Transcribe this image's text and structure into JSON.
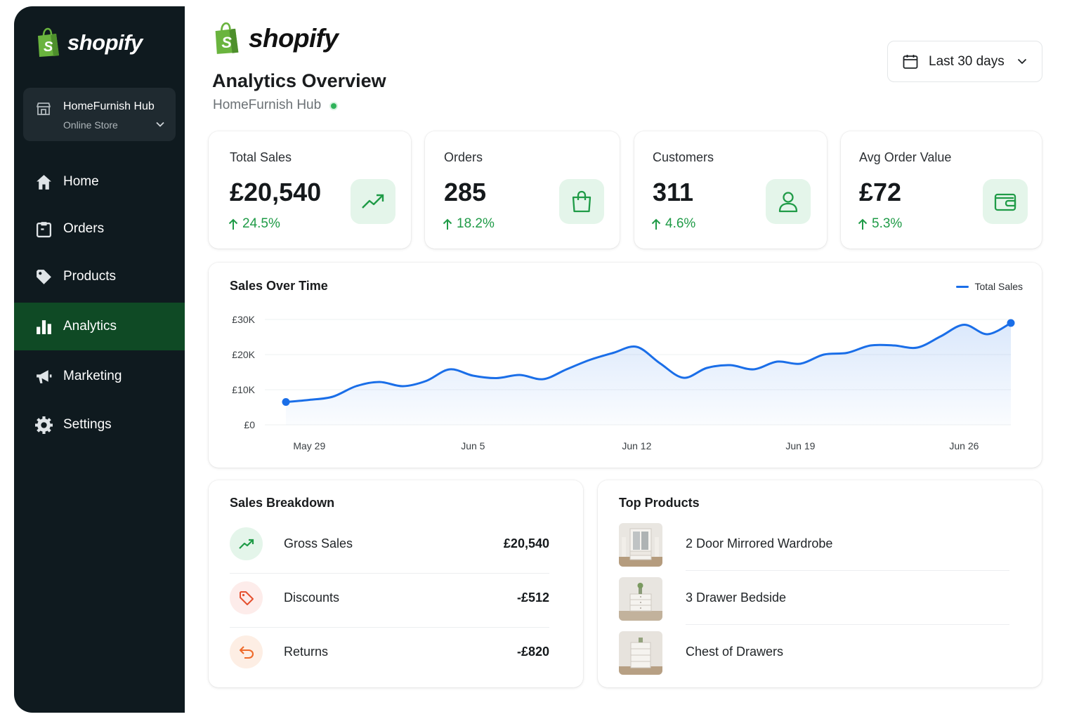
{
  "brand": {
    "name": "shopify"
  },
  "sidebar": {
    "store": {
      "name": "HomeFurnish Hub",
      "type": "Online Store"
    },
    "items": [
      {
        "label": "Home",
        "icon": "home-icon"
      },
      {
        "label": "Orders",
        "icon": "orders-icon"
      },
      {
        "label": "Products",
        "icon": "tag-icon"
      },
      {
        "label": "Analytics",
        "icon": "bar-chart-icon",
        "active": true
      },
      {
        "label": "Marketing",
        "icon": "megaphone-icon"
      },
      {
        "label": "Settings",
        "icon": "gear-icon"
      }
    ]
  },
  "header": {
    "title": "Analytics Overview",
    "store_name": "HomeFurnish Hub",
    "date_range": "Last 30 days"
  },
  "kpis": [
    {
      "title": "Total Sales",
      "value": "£20,540",
      "change": "24.5%",
      "icon": "trend-up-icon"
    },
    {
      "title": "Orders",
      "value": "285",
      "change": "18.2%",
      "icon": "shopping-bag-icon"
    },
    {
      "title": "Customers",
      "value": "311",
      "change": "4.6%",
      "icon": "user-icon"
    },
    {
      "title": "Avg Order Value",
      "value": "£72",
      "change": "5.3%",
      "icon": "wallet-icon"
    }
  ],
  "chart_data": {
    "type": "area",
    "title": "Sales Over Time",
    "y_ticks": [
      "£30K",
      "£20K",
      "£10K",
      "£0"
    ],
    "x_ticks": [
      "May 29",
      "Jun 5",
      "Jun 12",
      "Jun 19",
      "Jun 26"
    ],
    "ylim": [
      0,
      30000
    ],
    "grid": true,
    "legend_position": "top-right",
    "series": [
      {
        "name": "Total Sales",
        "color": "#1a6ee8",
        "x": [
          "May 28",
          "May 29",
          "May 30",
          "May 31",
          "Jun 1",
          "Jun 2",
          "Jun 3",
          "Jun 4",
          "Jun 5",
          "Jun 6",
          "Jun 7",
          "Jun 8",
          "Jun 9",
          "Jun 10",
          "Jun 11",
          "Jun 12",
          "Jun 13",
          "Jun 14",
          "Jun 15",
          "Jun 16",
          "Jun 17",
          "Jun 18",
          "Jun 19",
          "Jun 20",
          "Jun 21",
          "Jun 22",
          "Jun 23",
          "Jun 24",
          "Jun 25",
          "Jun 26",
          "Jun 27",
          "Jun 28"
        ],
        "values": [
          6500,
          7100,
          8000,
          11000,
          12200,
          11000,
          12500,
          15800,
          14000,
          13300,
          14200,
          13000,
          15800,
          18500,
          20500,
          22200,
          17500,
          13400,
          16200,
          17000,
          15800,
          18000,
          17400,
          20000,
          20500,
          22600,
          22600,
          22000,
          25200,
          28500,
          25800,
          29000
        ]
      }
    ]
  },
  "breakdown": {
    "title": "Sales Breakdown",
    "rows": [
      {
        "label": "Gross Sales",
        "value": "£20,540",
        "icon": "trend-up-icon"
      },
      {
        "label": "Discounts",
        "value": "-£512",
        "icon": "discount-tag-icon"
      },
      {
        "label": "Returns",
        "value": "-£820",
        "icon": "return-arrow-icon"
      }
    ]
  },
  "top_products": {
    "title": "Top Products",
    "items": [
      {
        "label": "2 Door Mirrored Wardrobe"
      },
      {
        "label": "3 Drawer Bedside"
      },
      {
        "label": "Chest of Drawers"
      }
    ]
  },
  "colors": {
    "sidebar_bg": "#0f1a1f",
    "sidebar_active": "#0f4a25",
    "positive": "#1f9b47",
    "chart_line": "#1a6ee8",
    "brand_green": "#5da83a"
  }
}
